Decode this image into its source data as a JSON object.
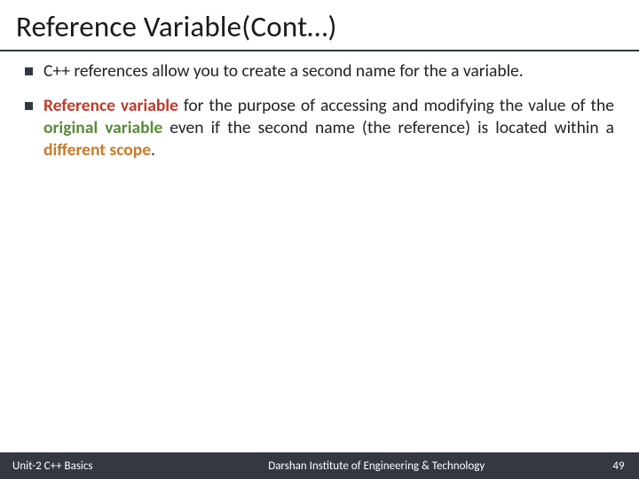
{
  "title": "Reference Variable(Cont…)",
  "bullets": [
    {
      "pre": "C++ references allow you to create a second name for the a variable."
    },
    {
      "spans": [
        {
          "t": "Reference variable",
          "cls": "em-red"
        },
        {
          "t": " for the purpose of accessing and modifying the value of the "
        },
        {
          "t": "original variable",
          "cls": "em-green"
        },
        {
          "t": " even if the second name (the reference) is located within a "
        },
        {
          "t": "different scope",
          "cls": "em-orange"
        },
        {
          "t": "."
        }
      ]
    }
  ],
  "footer": {
    "left": "Unit-2 C++ Basics",
    "center": "Darshan Institute of Engineering & Technology",
    "right": "49"
  }
}
